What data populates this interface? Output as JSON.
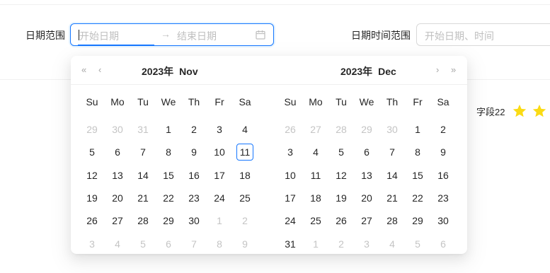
{
  "form": {
    "date_range_label": "日期范围",
    "date_range": {
      "start_placeholder": "开始日期",
      "end_placeholder": "结束日期",
      "separator": "→"
    },
    "datetime_range_label": "日期时间范围",
    "datetime_range": {
      "start_placeholder": "开始日期、时间"
    },
    "field22_label": "字段22",
    "field22_rating_visible_stars": 2
  },
  "picker": {
    "weekdays": [
      "Su",
      "Mo",
      "Tu",
      "We",
      "Th",
      "Fr",
      "Sa"
    ],
    "nav": {
      "super_prev": "«",
      "prev": "‹",
      "next": "›",
      "super_next": "»"
    },
    "left": {
      "year_label": "2023年",
      "month_label": "Nov",
      "days": [
        [
          "29",
          "30",
          "31",
          "1",
          "2",
          "3",
          "4"
        ],
        [
          "5",
          "6",
          "7",
          "8",
          "9",
          "10",
          "11"
        ],
        [
          "12",
          "13",
          "14",
          "15",
          "16",
          "17",
          "18"
        ],
        [
          "19",
          "20",
          "21",
          "22",
          "23",
          "24",
          "25"
        ],
        [
          "26",
          "27",
          "28",
          "29",
          "30",
          "1",
          "2"
        ],
        [
          "3",
          "4",
          "5",
          "6",
          "7",
          "8",
          "9"
        ]
      ],
      "out_of_month": [
        [
          0,
          0
        ],
        [
          0,
          1
        ],
        [
          0,
          2
        ],
        [
          4,
          5
        ],
        [
          4,
          6
        ],
        [
          5,
          0
        ],
        [
          5,
          1
        ],
        [
          5,
          2
        ],
        [
          5,
          3
        ],
        [
          5,
          4
        ],
        [
          5,
          5
        ],
        [
          5,
          6
        ]
      ],
      "today": [
        1,
        6
      ]
    },
    "right": {
      "year_label": "2023年",
      "month_label": "Dec",
      "days": [
        [
          "26",
          "27",
          "28",
          "29",
          "30",
          "1",
          "2"
        ],
        [
          "3",
          "4",
          "5",
          "6",
          "7",
          "8",
          "9"
        ],
        [
          "10",
          "11",
          "12",
          "13",
          "14",
          "15",
          "16"
        ],
        [
          "17",
          "18",
          "19",
          "20",
          "21",
          "22",
          "23"
        ],
        [
          "24",
          "25",
          "26",
          "27",
          "28",
          "29",
          "30"
        ],
        [
          "31",
          "1",
          "2",
          "3",
          "4",
          "5",
          "6"
        ]
      ],
      "out_of_month": [
        [
          0,
          0
        ],
        [
          0,
          1
        ],
        [
          0,
          2
        ],
        [
          0,
          3
        ],
        [
          0,
          4
        ],
        [
          5,
          1
        ],
        [
          5,
          2
        ],
        [
          5,
          3
        ],
        [
          5,
          4
        ],
        [
          5,
          5
        ],
        [
          5,
          6
        ]
      ]
    }
  },
  "colors": {
    "accent": "#1677ff",
    "star": "#fadb14",
    "muted_text": "#bfbfbf"
  }
}
